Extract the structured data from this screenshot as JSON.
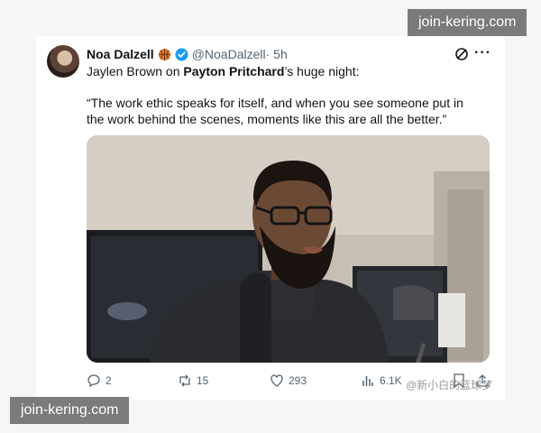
{
  "tweet": {
    "author_name": "Noa Dalzell",
    "badge_emoji_icon": "basketball-icon",
    "handle": "@NoaDalzell",
    "time": " · 5h",
    "text_prefix": "Jaylen Brown on ",
    "text_name": "Payton Pritchard",
    "text_suffix": "’s huge night:",
    "quote": "“The work ethic speaks for itself, and when you see someone put in the work behind the scenes, moments like this are all the better.”"
  },
  "actions": {
    "replies": "2",
    "reposts": "15",
    "likes": "293",
    "views": "6.1K"
  },
  "watermarks": {
    "top": "join-kering.com",
    "bottom": "join-kering.com",
    "cn": "@新小白的篮球梦"
  },
  "colors": {
    "verified": "#1d9bf0",
    "muted": "#536471",
    "watermark_bg": "#5f5f5f"
  }
}
